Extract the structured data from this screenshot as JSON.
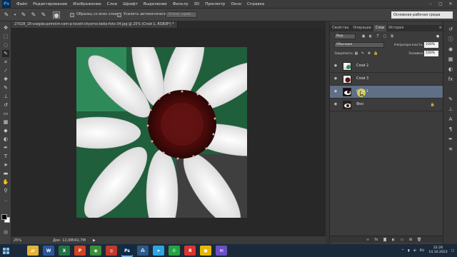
{
  "menubar": {
    "logo": "Ps",
    "items": [
      "Файл",
      "Редактирование",
      "Изображение",
      "Слои",
      "Шрифт",
      "Выделение",
      "Фильтр",
      "3D",
      "Просмотр",
      "Окно",
      "Справка"
    ],
    "window_controls": [
      "–",
      "▢",
      "✕"
    ]
  },
  "options": {
    "sample_all_layers_label": "Образец со всех слоев",
    "auto_enhance_label": "Усилить автоматически",
    "refine_edge_label": "Уточн. край...",
    "workspace": "Основная рабочая среда"
  },
  "document": {
    "tab_title": "27028_18-vsegda-pomnim-com-p-tsveti-chyorno-belie-foto-34.jpg @ 25% (Слой 1, RGB/8*) *",
    "zoom": "25%",
    "doc_info": "Док: 12,0M/42,7M",
    "status_arrow": "▶"
  },
  "panels": {
    "tabs": [
      "Свойства",
      "Операции",
      "Слои",
      "История"
    ],
    "active_tab": "Слои",
    "filter_kind": "Вид",
    "blend_mode": "Обычные",
    "opacity_label": "Непрозрачность:",
    "opacity_value": "100%",
    "lock_label": "Закрепить:",
    "fill_label": "Заливка:",
    "fill_value": "100%",
    "menu_icon": "≡"
  },
  "layers": [
    {
      "name": "Слой 2",
      "selected": false,
      "locked": false
    },
    {
      "name": "Слой 3",
      "selected": false,
      "locked": false
    },
    {
      "name": "Слой 1",
      "selected": true,
      "locked": false
    },
    {
      "name": "Фон",
      "selected": false,
      "locked": true
    }
  ],
  "taskbar": {
    "language": "RU",
    "time": "22:26",
    "date": "14.10.2023",
    "apps": [
      {
        "name": "file-explorer",
        "glyph": "📁",
        "color": "#e3b23c"
      },
      {
        "name": "word",
        "glyph": "W",
        "color": "#2b579a"
      },
      {
        "name": "excel",
        "glyph": "X",
        "color": "#217346"
      },
      {
        "name": "powerpoint",
        "glyph": "P",
        "color": "#d04423"
      },
      {
        "name": "chrome",
        "glyph": "◉",
        "color": "#3a8f3a"
      },
      {
        "name": "yandex-browser",
        "glyph": "◎",
        "color": "#c0392b"
      },
      {
        "name": "photoshop",
        "glyph": "Ps",
        "color": "#0d2a4a"
      },
      {
        "name": "network",
        "glyph": "⁂",
        "color": "#2c5a8a"
      },
      {
        "name": "telegram",
        "glyph": "➤",
        "color": "#2ca5e0"
      },
      {
        "name": "whatsapp",
        "glyph": "✆",
        "color": "#25a244"
      },
      {
        "name": "yandex",
        "glyph": "Я",
        "color": "#d9352f"
      },
      {
        "name": "app-yellow",
        "glyph": "●",
        "color": "#e6b800"
      },
      {
        "name": "viber",
        "glyph": "✉",
        "color": "#6d4fc4"
      }
    ]
  }
}
